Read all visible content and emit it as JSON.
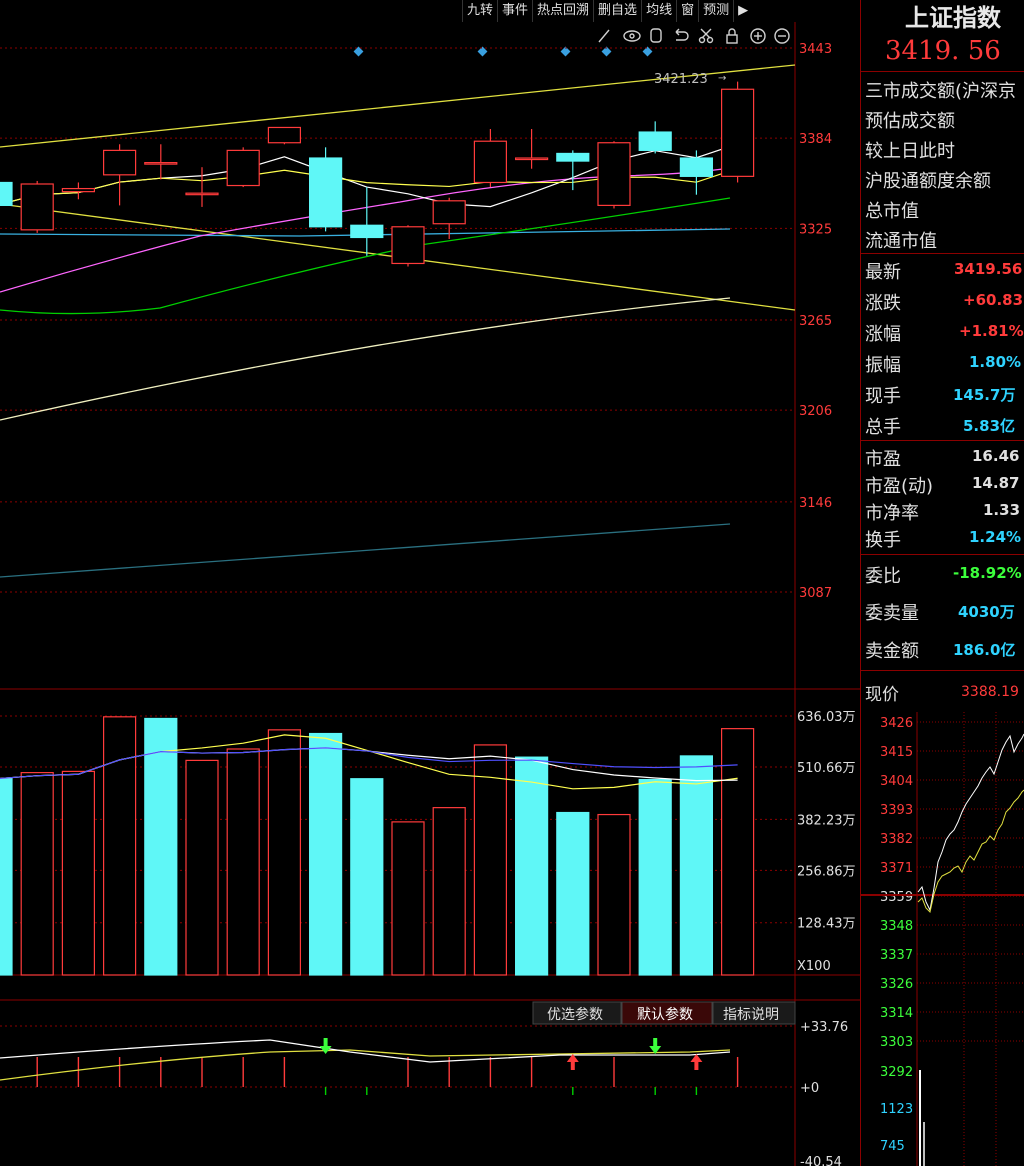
{
  "toolbar": {
    "items": [
      "九转",
      "事件",
      "热点回溯",
      "删自选",
      "均线",
      "窗",
      "预测"
    ]
  },
  "main_chart": {
    "y_ticks": [
      "3443",
      "3384",
      "3325",
      "3265",
      "3206",
      "3146",
      "3087"
    ],
    "peak_label": "3421.23"
  },
  "volume_chart": {
    "y_ticks": [
      "636.03万",
      "510.66万",
      "382.23万",
      "256.86万",
      "128.43万"
    ],
    "unit_label": "X100"
  },
  "indicator_panel": {
    "buttons": [
      "优选参数",
      "默认参数",
      "指标说明"
    ],
    "y_ticks": [
      "+33.76",
      "+0",
      "-40.54"
    ]
  },
  "quote_panel": {
    "title": "上证指数",
    "price": "3419. 56",
    "info_labels": [
      "三市成交额(沪深京",
      "预估成交额",
      "较上日此时",
      "沪股通额度余额",
      "总市值",
      "流通市值"
    ],
    "rows": [
      {
        "label": "最新",
        "value": "3419.56",
        "color": "#ff3b3b"
      },
      {
        "label": "涨跌",
        "value": "+60.83",
        "color": "#ff3b3b"
      },
      {
        "label": "涨幅",
        "value": "+1.81%",
        "color": "#ff3b3b"
      },
      {
        "label": "振幅",
        "value": "1.80%",
        "color": "#2fd3ff"
      },
      {
        "label": "现手",
        "value": "145.7万",
        "color": "#2fd3ff"
      },
      {
        "label": "总手",
        "value": "5.83亿",
        "color": "#2fd3ff"
      }
    ],
    "rows2": [
      {
        "label": "市盈",
        "value": "16.46"
      },
      {
        "label": "市盈(动)",
        "value": "14.87"
      },
      {
        "label": "市净率",
        "value": "1.33"
      },
      {
        "label": "换手",
        "value": "1.24%",
        "color": "#2fd3ff"
      }
    ],
    "rows3": [
      {
        "label": "委比",
        "value": "-18.92%",
        "color": "#3cff3c"
      },
      {
        "label": "委卖量",
        "value": "4030万",
        "color": "#2fd3ff"
      },
      {
        "label": "卖金额",
        "value": "186.0亿",
        "color": "#2fd3ff"
      }
    ],
    "current_price_label": "现价",
    "current_price_value": "3388.19"
  },
  "mini_chart": {
    "y_ticks": [
      "3426",
      "3415",
      "3404",
      "3393",
      "3382",
      "3371",
      "3359",
      "3348",
      "3337",
      "3326",
      "3314",
      "3303"
    ],
    "vol_ticks": [
      "3292",
      "1123",
      "745"
    ]
  },
  "chart_data": {
    "type": "candlestick",
    "colors": {
      "up": "#ff3b3b",
      "down": "#5ff7f7",
      "ma5": "#ffffff",
      "ma10": "#ffff4f",
      "ma20": "#ff66ff",
      "ma60": "#00d000",
      "trend": "#e0e040",
      "long": "#f0f0c0",
      "flat": "#39b0e0"
    },
    "price_axis": {
      "min": 3087,
      "max": 3443
    },
    "candles": [
      {
        "open": 3355,
        "close": 3340,
        "high": 3360,
        "low": 3335
      },
      {
        "open": 3324,
        "close": 3354,
        "high": 3356,
        "low": 3322
      },
      {
        "open": 3349,
        "close": 3351,
        "high": 3355,
        "low": 3344
      },
      {
        "open": 3360,
        "close": 3376,
        "high": 3380,
        "low": 3340
      },
      {
        "open": 3368,
        "close": 3368,
        "high": 3380,
        "low": 3357
      },
      {
        "open": 3348,
        "close": 3348,
        "high": 3365,
        "low": 3339
      },
      {
        "open": 3353,
        "close": 3376,
        "high": 3378,
        "low": 3352
      },
      {
        "open": 3381,
        "close": 3391,
        "high": 3391,
        "low": 3380
      },
      {
        "open": 3371,
        "close": 3326,
        "high": 3378,
        "low": 3323
      },
      {
        "open": 3327,
        "close": 3319,
        "high": 3352,
        "low": 3307
      },
      {
        "open": 3302,
        "close": 3326,
        "high": 3327,
        "low": 3300
      },
      {
        "open": 3328,
        "close": 3343,
        "high": 3345,
        "low": 3318
      },
      {
        "open": 3355,
        "close": 3382,
        "high": 3390,
        "low": 3352
      },
      {
        "open": 3371,
        "close": 3371,
        "high": 3390,
        "low": 3364
      },
      {
        "open": 3374,
        "close": 3369,
        "high": 3376,
        "low": 3350
      },
      {
        "open": 3340,
        "close": 3381,
        "high": 3382,
        "low": 3338
      },
      {
        "open": 3388,
        "close": 3376,
        "high": 3395,
        "low": 3374
      },
      {
        "open": 3371,
        "close": 3359,
        "high": 3376,
        "low": 3347
      },
      {
        "open": 3359,
        "close": 3416,
        "high": 3421,
        "low": 3355
      }
    ],
    "volume_axis": {
      "min": 0,
      "max": 636.03,
      "unit": "万"
    },
    "volumes": [
      {
        "value": 482,
        "up": false
      },
      {
        "value": 497,
        "up": true
      },
      {
        "value": 500,
        "up": true
      },
      {
        "value": 634,
        "up": true
      },
      {
        "value": 630,
        "up": false
      },
      {
        "value": 527,
        "up": true
      },
      {
        "value": 555,
        "up": true
      },
      {
        "value": 602,
        "up": true
      },
      {
        "value": 593,
        "up": false
      },
      {
        "value": 482,
        "up": false
      },
      {
        "value": 376,
        "up": true
      },
      {
        "value": 411,
        "up": true
      },
      {
        "value": 565,
        "up": true
      },
      {
        "value": 535,
        "up": false
      },
      {
        "value": 399,
        "up": false
      },
      {
        "value": 394,
        "up": true
      },
      {
        "value": 480,
        "up": false
      },
      {
        "value": 538,
        "up": false
      },
      {
        "value": 605,
        "up": true
      }
    ],
    "indicator_axis": {
      "min": -40.54,
      "max": 33.76
    },
    "signals": [
      {
        "index": 8,
        "dir": "down"
      },
      {
        "index": 14,
        "dir": "up"
      },
      {
        "index": 16,
        "dir": "down"
      },
      {
        "index": 17,
        "dir": "up"
      }
    ]
  }
}
